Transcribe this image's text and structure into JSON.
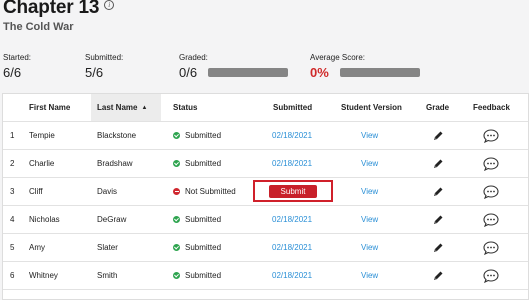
{
  "header": {
    "title": "Chapter 13",
    "subtitle": "The Cold War"
  },
  "stats": {
    "started_label": "Started:",
    "started_value": "6/6",
    "submitted_label": "Submitted:",
    "submitted_value": "5/6",
    "graded_label": "Graded:",
    "graded_value": "0/6",
    "average_label": "Average Score:",
    "average_value": "0%",
    "accent_red": "#d02a2a"
  },
  "table": {
    "columns": {
      "first": "First Name",
      "last": "Last Name",
      "status": "Status",
      "submitted": "Submitted",
      "version": "Student Version",
      "grade": "Grade",
      "feedback": "Feedback"
    },
    "sort_indicator": "▲",
    "submit_label": "Submit",
    "rows": [
      {
        "num": "1",
        "first": "Tempie",
        "last": "Blackstone",
        "status": "Submitted",
        "date": "02/18/2021",
        "view": "View"
      },
      {
        "num": "2",
        "first": "Charlie",
        "last": "Bradshaw",
        "status": "Submitted",
        "date": "02/18/2021",
        "view": "View"
      },
      {
        "num": "3",
        "first": "Cliff",
        "last": "Davis",
        "status": "Not Submitted",
        "date": "",
        "view": "View"
      },
      {
        "num": "4",
        "first": "Nicholas",
        "last": "DeGraw",
        "status": "Submitted",
        "date": "02/18/2021",
        "view": "View"
      },
      {
        "num": "5",
        "first": "Amy",
        "last": "Slater",
        "status": "Submitted",
        "date": "02/18/2021",
        "view": "View"
      },
      {
        "num": "6",
        "first": "Whitney",
        "last": "Smith",
        "status": "Submitted",
        "date": "02/18/2021",
        "view": "View"
      }
    ]
  }
}
